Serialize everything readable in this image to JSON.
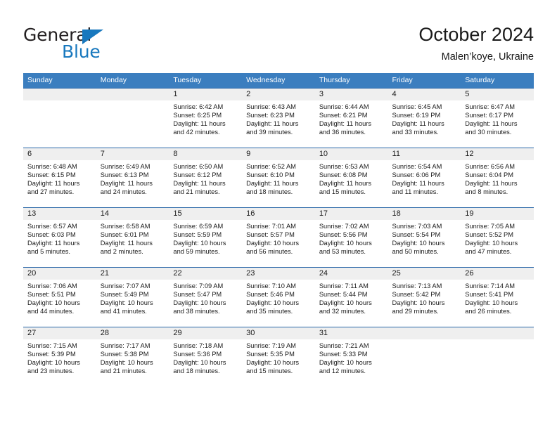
{
  "brand": {
    "name_top": "General",
    "name_bottom": "Blue",
    "accent_color": "#1878be"
  },
  "header": {
    "title": "October 2024",
    "subtitle": "Malen’koye, Ukraine"
  },
  "calendar": {
    "header_bg": "#3b7ebf",
    "header_text_color": "#ffffff",
    "row_divider_color": "#2a67a8",
    "daynum_band_color": "#efefef",
    "weekdays": [
      "Sunday",
      "Monday",
      "Tuesday",
      "Wednesday",
      "Thursday",
      "Friday",
      "Saturday"
    ],
    "weeks": [
      [
        {
          "day": "",
          "empty": true,
          "lines": []
        },
        {
          "day": "",
          "empty": true,
          "lines": []
        },
        {
          "day": "1",
          "empty": false,
          "lines": [
            "Sunrise: 6:42 AM",
            "Sunset: 6:25 PM",
            "Daylight: 11 hours",
            "and 42 minutes."
          ]
        },
        {
          "day": "2",
          "empty": false,
          "lines": [
            "Sunrise: 6:43 AM",
            "Sunset: 6:23 PM",
            "Daylight: 11 hours",
            "and 39 minutes."
          ]
        },
        {
          "day": "3",
          "empty": false,
          "lines": [
            "Sunrise: 6:44 AM",
            "Sunset: 6:21 PM",
            "Daylight: 11 hours",
            "and 36 minutes."
          ]
        },
        {
          "day": "4",
          "empty": false,
          "lines": [
            "Sunrise: 6:45 AM",
            "Sunset: 6:19 PM",
            "Daylight: 11 hours",
            "and 33 minutes."
          ]
        },
        {
          "day": "5",
          "empty": false,
          "lines": [
            "Sunrise: 6:47 AM",
            "Sunset: 6:17 PM",
            "Daylight: 11 hours",
            "and 30 minutes."
          ]
        }
      ],
      [
        {
          "day": "6",
          "empty": false,
          "lines": [
            "Sunrise: 6:48 AM",
            "Sunset: 6:15 PM",
            "Daylight: 11 hours",
            "and 27 minutes."
          ]
        },
        {
          "day": "7",
          "empty": false,
          "lines": [
            "Sunrise: 6:49 AM",
            "Sunset: 6:13 PM",
            "Daylight: 11 hours",
            "and 24 minutes."
          ]
        },
        {
          "day": "8",
          "empty": false,
          "lines": [
            "Sunrise: 6:50 AM",
            "Sunset: 6:12 PM",
            "Daylight: 11 hours",
            "and 21 minutes."
          ]
        },
        {
          "day": "9",
          "empty": false,
          "lines": [
            "Sunrise: 6:52 AM",
            "Sunset: 6:10 PM",
            "Daylight: 11 hours",
            "and 18 minutes."
          ]
        },
        {
          "day": "10",
          "empty": false,
          "lines": [
            "Sunrise: 6:53 AM",
            "Sunset: 6:08 PM",
            "Daylight: 11 hours",
            "and 15 minutes."
          ]
        },
        {
          "day": "11",
          "empty": false,
          "lines": [
            "Sunrise: 6:54 AM",
            "Sunset: 6:06 PM",
            "Daylight: 11 hours",
            "and 11 minutes."
          ]
        },
        {
          "day": "12",
          "empty": false,
          "lines": [
            "Sunrise: 6:56 AM",
            "Sunset: 6:04 PM",
            "Daylight: 11 hours",
            "and 8 minutes."
          ]
        }
      ],
      [
        {
          "day": "13",
          "empty": false,
          "lines": [
            "Sunrise: 6:57 AM",
            "Sunset: 6:03 PM",
            "Daylight: 11 hours",
            "and 5 minutes."
          ]
        },
        {
          "day": "14",
          "empty": false,
          "lines": [
            "Sunrise: 6:58 AM",
            "Sunset: 6:01 PM",
            "Daylight: 11 hours",
            "and 2 minutes."
          ]
        },
        {
          "day": "15",
          "empty": false,
          "lines": [
            "Sunrise: 6:59 AM",
            "Sunset: 5:59 PM",
            "Daylight: 10 hours",
            "and 59 minutes."
          ]
        },
        {
          "day": "16",
          "empty": false,
          "lines": [
            "Sunrise: 7:01 AM",
            "Sunset: 5:57 PM",
            "Daylight: 10 hours",
            "and 56 minutes."
          ]
        },
        {
          "day": "17",
          "empty": false,
          "lines": [
            "Sunrise: 7:02 AM",
            "Sunset: 5:56 PM",
            "Daylight: 10 hours",
            "and 53 minutes."
          ]
        },
        {
          "day": "18",
          "empty": false,
          "lines": [
            "Sunrise: 7:03 AM",
            "Sunset: 5:54 PM",
            "Daylight: 10 hours",
            "and 50 minutes."
          ]
        },
        {
          "day": "19",
          "empty": false,
          "lines": [
            "Sunrise: 7:05 AM",
            "Sunset: 5:52 PM",
            "Daylight: 10 hours",
            "and 47 minutes."
          ]
        }
      ],
      [
        {
          "day": "20",
          "empty": false,
          "lines": [
            "Sunrise: 7:06 AM",
            "Sunset: 5:51 PM",
            "Daylight: 10 hours",
            "and 44 minutes."
          ]
        },
        {
          "day": "21",
          "empty": false,
          "lines": [
            "Sunrise: 7:07 AM",
            "Sunset: 5:49 PM",
            "Daylight: 10 hours",
            "and 41 minutes."
          ]
        },
        {
          "day": "22",
          "empty": false,
          "lines": [
            "Sunrise: 7:09 AM",
            "Sunset: 5:47 PM",
            "Daylight: 10 hours",
            "and 38 minutes."
          ]
        },
        {
          "day": "23",
          "empty": false,
          "lines": [
            "Sunrise: 7:10 AM",
            "Sunset: 5:46 PM",
            "Daylight: 10 hours",
            "and 35 minutes."
          ]
        },
        {
          "day": "24",
          "empty": false,
          "lines": [
            "Sunrise: 7:11 AM",
            "Sunset: 5:44 PM",
            "Daylight: 10 hours",
            "and 32 minutes."
          ]
        },
        {
          "day": "25",
          "empty": false,
          "lines": [
            "Sunrise: 7:13 AM",
            "Sunset: 5:42 PM",
            "Daylight: 10 hours",
            "and 29 minutes."
          ]
        },
        {
          "day": "26",
          "empty": false,
          "lines": [
            "Sunrise: 7:14 AM",
            "Sunset: 5:41 PM",
            "Daylight: 10 hours",
            "and 26 minutes."
          ]
        }
      ],
      [
        {
          "day": "27",
          "empty": false,
          "lines": [
            "Sunrise: 7:15 AM",
            "Sunset: 5:39 PM",
            "Daylight: 10 hours",
            "and 23 minutes."
          ]
        },
        {
          "day": "28",
          "empty": false,
          "lines": [
            "Sunrise: 7:17 AM",
            "Sunset: 5:38 PM",
            "Daylight: 10 hours",
            "and 21 minutes."
          ]
        },
        {
          "day": "29",
          "empty": false,
          "lines": [
            "Sunrise: 7:18 AM",
            "Sunset: 5:36 PM",
            "Daylight: 10 hours",
            "and 18 minutes."
          ]
        },
        {
          "day": "30",
          "empty": false,
          "lines": [
            "Sunrise: 7:19 AM",
            "Sunset: 5:35 PM",
            "Daylight: 10 hours",
            "and 15 minutes."
          ]
        },
        {
          "day": "31",
          "empty": false,
          "lines": [
            "Sunrise: 7:21 AM",
            "Sunset: 5:33 PM",
            "Daylight: 10 hours",
            "and 12 minutes."
          ]
        },
        {
          "day": "",
          "empty": true,
          "lines": []
        },
        {
          "day": "",
          "empty": true,
          "lines": []
        }
      ]
    ]
  }
}
